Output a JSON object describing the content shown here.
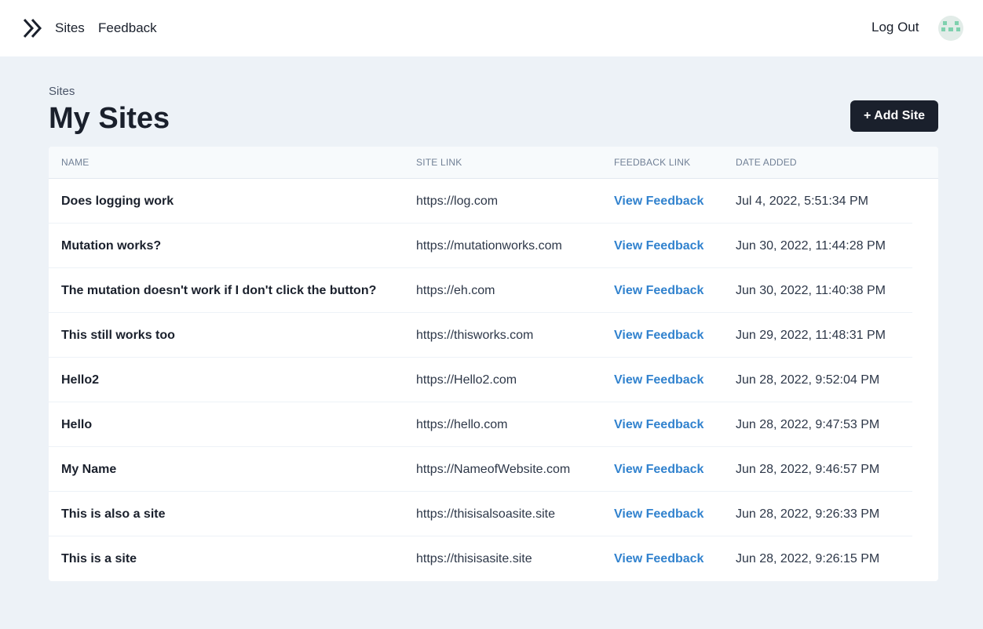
{
  "nav": {
    "sites": "Sites",
    "feedback": "Feedback",
    "logout": "Log Out"
  },
  "page": {
    "breadcrumb": "Sites",
    "title": "My Sites",
    "add_button": "+ Add Site"
  },
  "table": {
    "headers": {
      "name": "NAME",
      "site_link": "SITE LINK",
      "feedback_link": "FEEDBACK LINK",
      "date_added": "DATE ADDED"
    },
    "rows": [
      {
        "name": "Does logging work",
        "link": "https://log.com",
        "feedback": "View Feedback",
        "date": "Jul 4, 2022, 5:51:34 PM"
      },
      {
        "name": "Mutation works?",
        "link": "https://mutationworks.com",
        "feedback": "View Feedback",
        "date": "Jun 30, 2022, 11:44:28 PM"
      },
      {
        "name": "The mutation doesn't work if I don't click the button?",
        "link": "https://eh.com",
        "feedback": "View Feedback",
        "date": "Jun 30, 2022, 11:40:38 PM"
      },
      {
        "name": "This still works too",
        "link": "https://thisworks.com",
        "feedback": "View Feedback",
        "date": "Jun 29, 2022, 11:48:31 PM"
      },
      {
        "name": "Hello2",
        "link": "https://Hello2.com",
        "feedback": "View Feedback",
        "date": "Jun 28, 2022, 9:52:04 PM"
      },
      {
        "name": "Hello",
        "link": "https://hello.com",
        "feedback": "View Feedback",
        "date": "Jun 28, 2022, 9:47:53 PM"
      },
      {
        "name": "My Name",
        "link": "https://NameofWebsite.com",
        "feedback": "View Feedback",
        "date": "Jun 28, 2022, 9:46:57 PM"
      },
      {
        "name": "This is also a site",
        "link": "https://thisisalsoasite.site",
        "feedback": "View Feedback",
        "date": "Jun 28, 2022, 9:26:33 PM"
      },
      {
        "name": "This is a site",
        "link": "https://thisisasite.site",
        "feedback": "View Feedback",
        "date": "Jun 28, 2022, 9:26:15 PM"
      }
    ]
  },
  "colors": {
    "background": "#edf2f7",
    "accent_link": "#3182ce",
    "button": "#1a202c",
    "avatar": "#7fd1ae"
  },
  "icons": {
    "logo": "double-chevron-right-icon",
    "avatar": "identicon-avatar"
  }
}
